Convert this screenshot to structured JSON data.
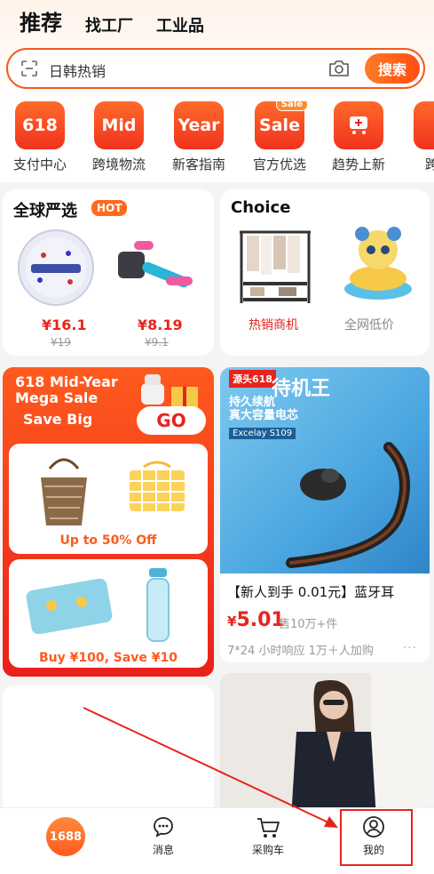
{
  "tabs": [
    "推荐",
    "找工厂",
    "工业品"
  ],
  "search": {
    "query": "日韩热销",
    "button": "搜索"
  },
  "shortcuts": [
    {
      "icon_text": "618",
      "label": "支付中心"
    },
    {
      "icon_text": "Mid",
      "label": "跨境物流"
    },
    {
      "icon_text": "Year",
      "label": "新客指南"
    },
    {
      "icon_text": "Sale",
      "label": "官方优选",
      "tag": "Sale"
    },
    {
      "icon_text": "",
      "label": "趋势上新"
    },
    {
      "icon_text": "",
      "label": "跨境"
    }
  ],
  "global_card": {
    "title": "全球严选",
    "badge": "HOT",
    "items": [
      {
        "price": "¥16.1",
        "old_price": "¥19"
      },
      {
        "price": "¥8.19",
        "old_price": "¥9.1"
      }
    ]
  },
  "choice_card": {
    "title": "Choice",
    "items": [
      {
        "caption": "热销商机"
      },
      {
        "caption": "全网低价"
      }
    ]
  },
  "promo": {
    "title": "618 Mid-Year Mega Sale",
    "save_big": "Save Big",
    "go": "GO",
    "box1_caption": "Up to 50% Off",
    "box2_caption": "Buy ¥100, Save ¥10"
  },
  "ad": {
    "badge": "源头618",
    "title": "待机王",
    "subtitle_line1": "持久续航",
    "subtitle_line2": "真大容量电芯",
    "tag": "Excelay  S109",
    "name": "【新人到手 0.01元】蓝牙耳",
    "price_symbol": "¥",
    "price": "5.01",
    "sold": "售10万+件",
    "meta": "7*24 小时响应   1万＋人加购",
    "more": "···"
  },
  "bottom_nav": [
    {
      "label": "1688",
      "icon": "home-logo"
    },
    {
      "label": "消息",
      "icon": "message-icon"
    },
    {
      "label": "采购车",
      "icon": "cart-icon"
    },
    {
      "label": "我的",
      "icon": "user-icon"
    }
  ],
  "colors": {
    "accent": "#ff5a1e",
    "price_red": "#e8231d"
  }
}
